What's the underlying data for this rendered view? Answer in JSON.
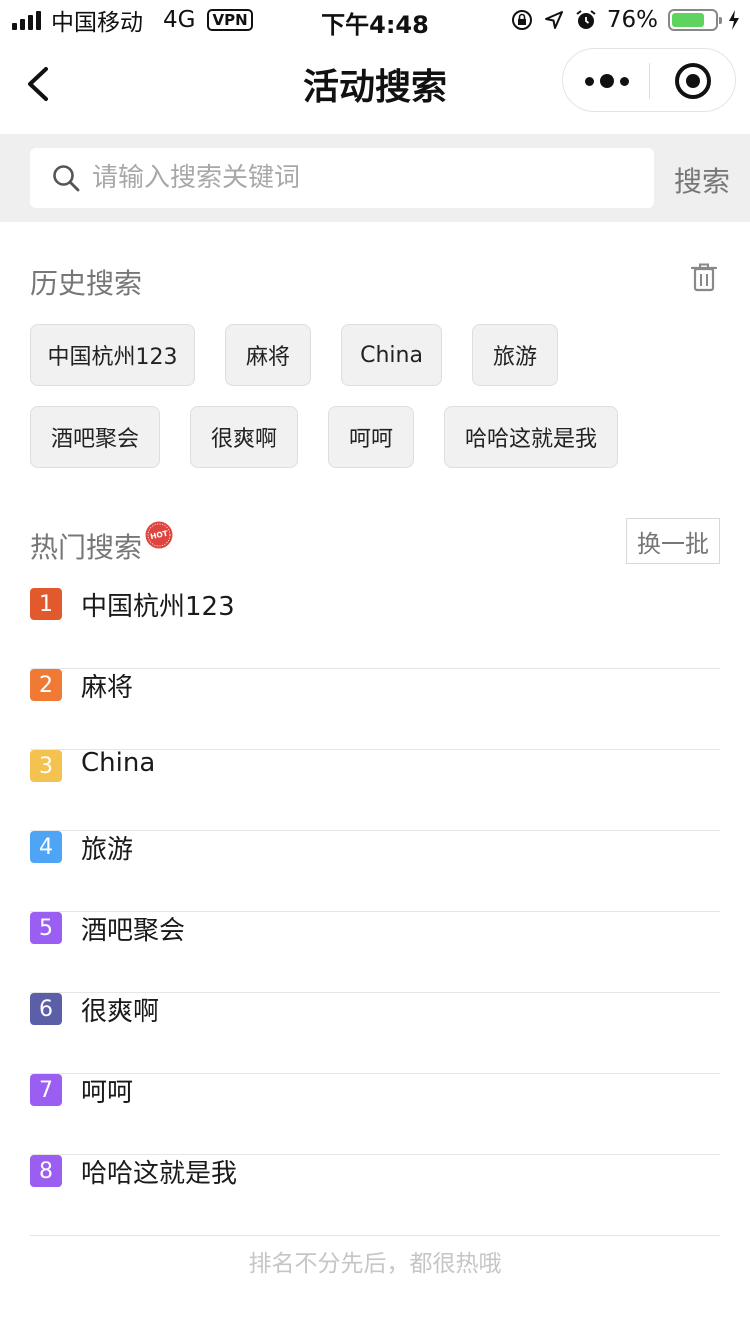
{
  "status_bar": {
    "carrier": "中国移动",
    "network": "4G",
    "vpn": "VPN",
    "time": "下午4:48",
    "battery": "76%",
    "battery_level": 0.76
  },
  "nav": {
    "title": "活动搜索"
  },
  "search": {
    "placeholder": "请输入搜索关键词",
    "button": "搜索"
  },
  "history": {
    "title": "历史搜索",
    "tags": [
      "中国杭州123",
      "麻将",
      "China",
      "旅游",
      "酒吧聚会",
      "很爽啊",
      "呵呵",
      "哈哈这就是我"
    ]
  },
  "hot": {
    "title": "热门搜索",
    "badge": "HOT",
    "refresh": "换一批",
    "items": [
      {
        "rank": "1",
        "text": "中国杭州123",
        "color": "#e2592e"
      },
      {
        "rank": "2",
        "text": "麻将",
        "color": "#f07a33"
      },
      {
        "rank": "3",
        "text": "China",
        "color": "#f3c24f"
      },
      {
        "rank": "4",
        "text": "旅游",
        "color": "#4ea5f5"
      },
      {
        "rank": "5",
        "text": "酒吧聚会",
        "color": "#9a5ef2"
      },
      {
        "rank": "6",
        "text": "很爽啊",
        "color": "#5a5fa8"
      },
      {
        "rank": "7",
        "text": "呵呵",
        "color": "#9a5ef2"
      },
      {
        "rank": "8",
        "text": "哈哈这就是我",
        "color": "#9a5ef2"
      }
    ],
    "footer": "排名不分先后，都很热哦"
  }
}
